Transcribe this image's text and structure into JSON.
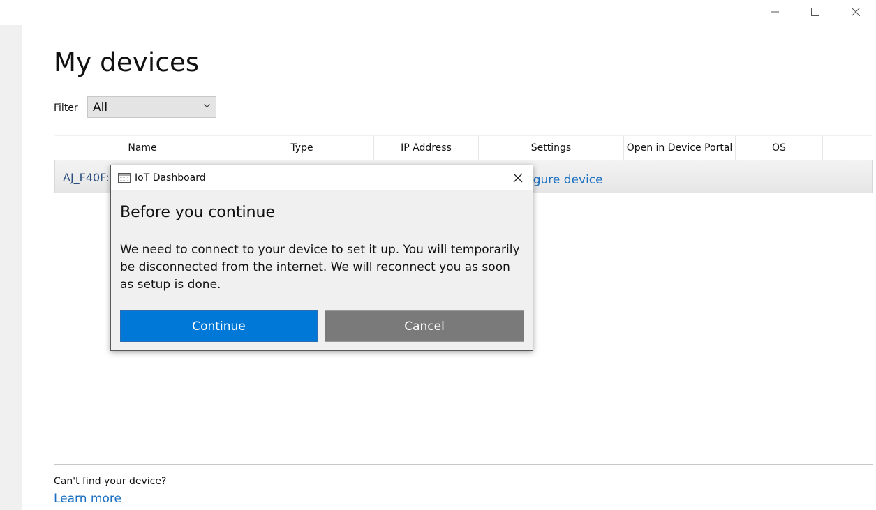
{
  "window": {
    "controls": [
      {
        "name": "minimize-button",
        "icon": "minimize-icon"
      },
      {
        "name": "maximize-button",
        "icon": "maximize-icon"
      },
      {
        "name": "close-button",
        "icon": "close-icon"
      }
    ]
  },
  "page": {
    "title": "My devices",
    "filter_label": "Filter",
    "filter_value": "All"
  },
  "grid": {
    "columns": [
      "Name",
      "Type",
      "IP Address",
      "Settings",
      "Open in Device Portal",
      "OS"
    ],
    "rows": [
      {
        "name": "AJ_F40F:",
        "settings": "figure device"
      }
    ]
  },
  "footer": {
    "text": "Can't find your device?",
    "link": "Learn more"
  },
  "dialog": {
    "title": "IoT Dashboard",
    "heading": "Before you continue",
    "body": "We need to connect to your device to set it up. You will temporarily be disconnected from the internet. We will reconnect you as soon as setup is done.",
    "continue_label": "Continue",
    "cancel_label": "Cancel"
  },
  "colors": {
    "accent": "#0078d7",
    "cancel": "#7a7a7a",
    "link": "#1a6fc0"
  }
}
